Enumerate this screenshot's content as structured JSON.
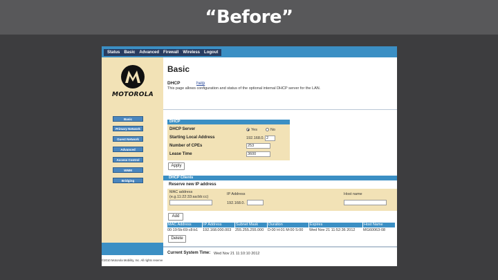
{
  "slide": {
    "title": "“Before”"
  },
  "topnav": {
    "items": [
      "Status",
      "Basic",
      "Advanced",
      "Firewall",
      "Wireless",
      "Logout"
    ]
  },
  "brand": {
    "logo_text": "MOTOROLA"
  },
  "sidebar": {
    "items": [
      "Basic",
      "Primary Network",
      "Guest Network",
      "Advanced",
      "Access Control",
      "WMM",
      "Bridging"
    ]
  },
  "footer": {
    "copyright": "©2010 Motorola Mobility, Inc. All rights reserve"
  },
  "page": {
    "title": "Basic",
    "section": "DHCP",
    "help_link": "help",
    "intro": "This page allows configuration and status of the optional internal DHCP server for the LAN."
  },
  "dhcp_panel": {
    "title": "DHCP",
    "server_label": "DHCP Server",
    "server_yes": "Yes",
    "server_no": "No",
    "start_label": "Starting Local Address",
    "start_prefix": "192.168.0.",
    "start_value": "2",
    "cpes_label": "Number of CPEs",
    "cpes_value": "253",
    "lease_label": "Lease Time",
    "lease_value": "3600",
    "apply_label": "Apply"
  },
  "clients": {
    "bar_title": "DHCP Clients",
    "reserve_title": "Reserve new IP address",
    "mac_label": "MAC address",
    "mac_hint": "(e.g.11:22:33:aa:bb:cc)",
    "ip_label": "IP Address",
    "ip_prefix": "192.168.0.",
    "host_label": "Host name",
    "add_label": "Add",
    "columns": [
      "MAC Address",
      "IP Address",
      "Subnet Mask",
      "Duration",
      "Expires",
      "Host Name"
    ],
    "row": {
      "mac": "00:19:5b:69:c8:b1",
      "ip": "192.168.000.003",
      "mask": "255.255.255.000",
      "duration": "D:00 H:01 M:00 S:00",
      "expires": "Wed Nov 21 11:52:36 2012",
      "host": "MG60063-08"
    },
    "delete_label": "Delete"
  },
  "system_time": {
    "label": "Current System Time:",
    "value": "Wed Nov 21 11:10:10 2012"
  }
}
